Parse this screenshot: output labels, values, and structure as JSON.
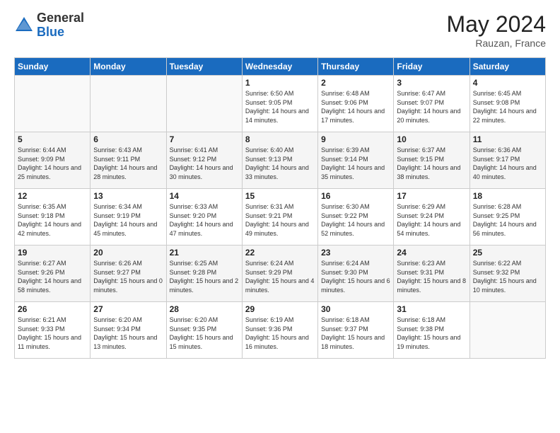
{
  "header": {
    "logo_general": "General",
    "logo_blue": "Blue",
    "month_title": "May 2024",
    "location": "Rauzan, France"
  },
  "days_of_week": [
    "Sunday",
    "Monday",
    "Tuesday",
    "Wednesday",
    "Thursday",
    "Friday",
    "Saturday"
  ],
  "weeks": [
    [
      {
        "day": "",
        "info": ""
      },
      {
        "day": "",
        "info": ""
      },
      {
        "day": "",
        "info": ""
      },
      {
        "day": "1",
        "info": "Sunrise: 6:50 AM\nSunset: 9:05 PM\nDaylight: 14 hours and 14 minutes."
      },
      {
        "day": "2",
        "info": "Sunrise: 6:48 AM\nSunset: 9:06 PM\nDaylight: 14 hours and 17 minutes."
      },
      {
        "day": "3",
        "info": "Sunrise: 6:47 AM\nSunset: 9:07 PM\nDaylight: 14 hours and 20 minutes."
      },
      {
        "day": "4",
        "info": "Sunrise: 6:45 AM\nSunset: 9:08 PM\nDaylight: 14 hours and 22 minutes."
      }
    ],
    [
      {
        "day": "5",
        "info": "Sunrise: 6:44 AM\nSunset: 9:09 PM\nDaylight: 14 hours and 25 minutes."
      },
      {
        "day": "6",
        "info": "Sunrise: 6:43 AM\nSunset: 9:11 PM\nDaylight: 14 hours and 28 minutes."
      },
      {
        "day": "7",
        "info": "Sunrise: 6:41 AM\nSunset: 9:12 PM\nDaylight: 14 hours and 30 minutes."
      },
      {
        "day": "8",
        "info": "Sunrise: 6:40 AM\nSunset: 9:13 PM\nDaylight: 14 hours and 33 minutes."
      },
      {
        "day": "9",
        "info": "Sunrise: 6:39 AM\nSunset: 9:14 PM\nDaylight: 14 hours and 35 minutes."
      },
      {
        "day": "10",
        "info": "Sunrise: 6:37 AM\nSunset: 9:15 PM\nDaylight: 14 hours and 38 minutes."
      },
      {
        "day": "11",
        "info": "Sunrise: 6:36 AM\nSunset: 9:17 PM\nDaylight: 14 hours and 40 minutes."
      }
    ],
    [
      {
        "day": "12",
        "info": "Sunrise: 6:35 AM\nSunset: 9:18 PM\nDaylight: 14 hours and 42 minutes."
      },
      {
        "day": "13",
        "info": "Sunrise: 6:34 AM\nSunset: 9:19 PM\nDaylight: 14 hours and 45 minutes."
      },
      {
        "day": "14",
        "info": "Sunrise: 6:33 AM\nSunset: 9:20 PM\nDaylight: 14 hours and 47 minutes."
      },
      {
        "day": "15",
        "info": "Sunrise: 6:31 AM\nSunset: 9:21 PM\nDaylight: 14 hours and 49 minutes."
      },
      {
        "day": "16",
        "info": "Sunrise: 6:30 AM\nSunset: 9:22 PM\nDaylight: 14 hours and 52 minutes."
      },
      {
        "day": "17",
        "info": "Sunrise: 6:29 AM\nSunset: 9:24 PM\nDaylight: 14 hours and 54 minutes."
      },
      {
        "day": "18",
        "info": "Sunrise: 6:28 AM\nSunset: 9:25 PM\nDaylight: 14 hours and 56 minutes."
      }
    ],
    [
      {
        "day": "19",
        "info": "Sunrise: 6:27 AM\nSunset: 9:26 PM\nDaylight: 14 hours and 58 minutes."
      },
      {
        "day": "20",
        "info": "Sunrise: 6:26 AM\nSunset: 9:27 PM\nDaylight: 15 hours and 0 minutes."
      },
      {
        "day": "21",
        "info": "Sunrise: 6:25 AM\nSunset: 9:28 PM\nDaylight: 15 hours and 2 minutes."
      },
      {
        "day": "22",
        "info": "Sunrise: 6:24 AM\nSunset: 9:29 PM\nDaylight: 15 hours and 4 minutes."
      },
      {
        "day": "23",
        "info": "Sunrise: 6:24 AM\nSunset: 9:30 PM\nDaylight: 15 hours and 6 minutes."
      },
      {
        "day": "24",
        "info": "Sunrise: 6:23 AM\nSunset: 9:31 PM\nDaylight: 15 hours and 8 minutes."
      },
      {
        "day": "25",
        "info": "Sunrise: 6:22 AM\nSunset: 9:32 PM\nDaylight: 15 hours and 10 minutes."
      }
    ],
    [
      {
        "day": "26",
        "info": "Sunrise: 6:21 AM\nSunset: 9:33 PM\nDaylight: 15 hours and 11 minutes."
      },
      {
        "day": "27",
        "info": "Sunrise: 6:20 AM\nSunset: 9:34 PM\nDaylight: 15 hours and 13 minutes."
      },
      {
        "day": "28",
        "info": "Sunrise: 6:20 AM\nSunset: 9:35 PM\nDaylight: 15 hours and 15 minutes."
      },
      {
        "day": "29",
        "info": "Sunrise: 6:19 AM\nSunset: 9:36 PM\nDaylight: 15 hours and 16 minutes."
      },
      {
        "day": "30",
        "info": "Sunrise: 6:18 AM\nSunset: 9:37 PM\nDaylight: 15 hours and 18 minutes."
      },
      {
        "day": "31",
        "info": "Sunrise: 6:18 AM\nSunset: 9:38 PM\nDaylight: 15 hours and 19 minutes."
      },
      {
        "day": "",
        "info": ""
      }
    ]
  ]
}
